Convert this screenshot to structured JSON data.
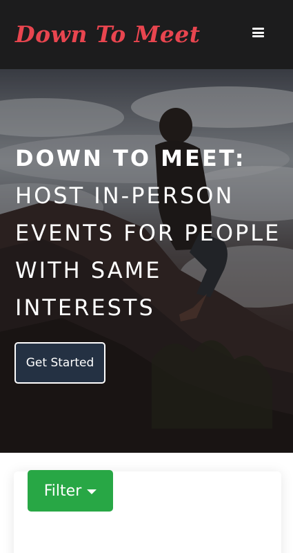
{
  "navbar": {
    "brand": "Down To Meet",
    "menu_icon": "hamburger-menu-icon"
  },
  "hero": {
    "title_strong": "DOWN TO MEET:",
    "title_rest": "HOST IN-PERSON EVENTS FOR PEOPLE WITH SAME INTERESTS",
    "cta_label": "Get Started",
    "background_image": "man-sitting-on-mountain-above-clouds"
  },
  "filter": {
    "label": "Filter",
    "caret_icon": "caret-down-icon"
  },
  "colors": {
    "navbar_bg": "#1c1c1d",
    "brand": "#e8454f",
    "cta_bg": "#243143",
    "filter_bg": "#28a745"
  }
}
